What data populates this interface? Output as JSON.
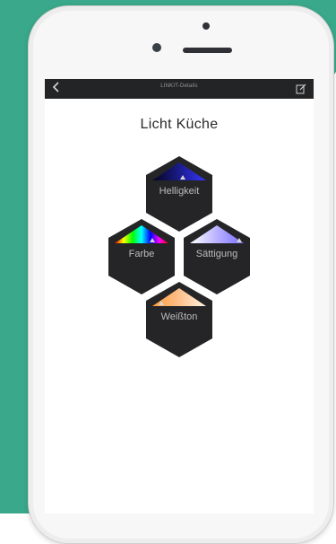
{
  "navbar": {
    "title": "LINKIT-Details"
  },
  "page": {
    "title": "Licht Küche"
  },
  "controls": [
    {
      "label": "Helligkeit"
    },
    {
      "label": "Farbe"
    },
    {
      "label": "Sättigung"
    },
    {
      "label": "Weißton"
    }
  ],
  "colors": {
    "background_shape": "#3aa88a",
    "navbar": "#232426",
    "hex_tile": "#252527",
    "title_text": "#2a2a2a"
  },
  "icons": {
    "back": "chevron-left-icon",
    "edit": "edit-icon"
  }
}
